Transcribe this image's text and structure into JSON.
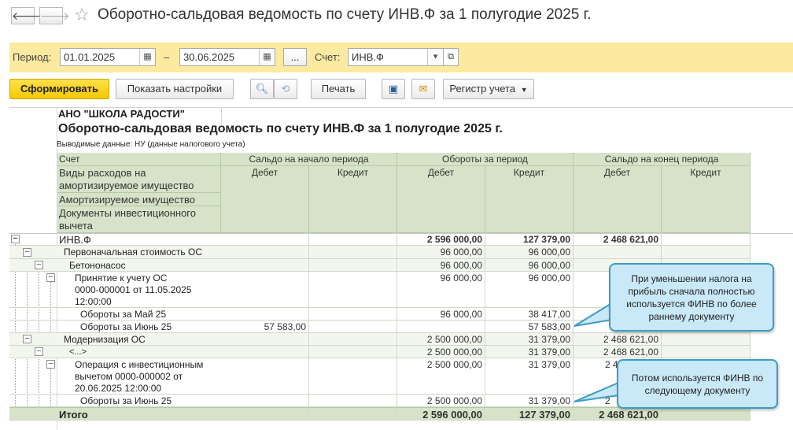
{
  "window": {
    "title": "Оборотно-сальдовая ведомость по счету ИНВ.Ф за 1 полугодие 2025 г.",
    "back_glyph": "🡐",
    "forward_glyph": "🡒",
    "star_glyph": "☆"
  },
  "params": {
    "period_label": "Период:",
    "date_from": "01.01.2025",
    "dash": "–",
    "date_to": "30.06.2025",
    "ellipsis": "...",
    "account_label": "Счет:",
    "account_value": "ИНВ.Ф"
  },
  "toolbar": {
    "generate": "Сформировать",
    "show_settings": "Показать настройки",
    "print": "Печать",
    "register": "Регистр учета"
  },
  "report": {
    "org": "АНО \"ШКОЛА РАДОСТИ\"",
    "title": "Оборотно-сальдовая ведомость по счету ИНВ.Ф за 1 полугодие 2025 г.",
    "output_data": "Выводимые данные: НУ (данные налогового учета)",
    "header": {
      "account": "Счет",
      "opening": "Сальдо на начало периода",
      "turnover": "Обороты за период",
      "closing": "Сальдо на конец периода",
      "debit": "Дебет",
      "credit": "Кредит",
      "subconto1_line1": "Виды расходов на",
      "subconto1_line2": "амортизируемое имущество",
      "subconto2": "Амортизируемое имущество",
      "subconto3_line1": "Документы инвестиционного",
      "subconto3_line2": "вычета"
    },
    "rows": [
      {
        "name": "ИНВ.Ф",
        "od": "",
        "oc": "",
        "td": "2 596 000,00",
        "tc": "127 379,00",
        "cd": "2 468 621,00",
        "cc": ""
      },
      {
        "name": "Первоначальная стоимость ОС",
        "od": "",
        "oc": "",
        "td": "96 000,00",
        "tc": "96 000,00",
        "cd": "",
        "cc": ""
      },
      {
        "name": "Бетононасос",
        "od": "",
        "oc": "",
        "td": "96 000,00",
        "tc": "96 000,00",
        "cd": "",
        "cc": ""
      },
      {
        "name1": "Принятие к учету ОС",
        "name2": "0000-000001 от 11.05.2025",
        "name3": "12:00:00",
        "od": "",
        "oc": "",
        "td": "96 000,00",
        "tc": "96 000,00",
        "cd": "",
        "cc": ""
      },
      {
        "name": "Обороты за Май 25",
        "od": "",
        "oc": "",
        "td": "96 000,00",
        "tc": "38 417,00",
        "cd": "",
        "cc": ""
      },
      {
        "name": "Обороты за Июнь 25",
        "od": "57 583,00",
        "oc": "",
        "td": "",
        "tc": "57 583,00",
        "cd": "",
        "cc": ""
      },
      {
        "name": "Модернизация ОС",
        "od": "",
        "oc": "",
        "td": "2 500 000,00",
        "tc": "31 379,00",
        "cd": "2 468 621,00",
        "cc": ""
      },
      {
        "name": "<...>",
        "od": "",
        "oc": "",
        "td": "2 500 000,00",
        "tc": "31 379,00",
        "cd": "2 468 621,00",
        "cc": ""
      },
      {
        "name1": "Операция с инвестиционным",
        "name2": "вычетом 0000-000002 от",
        "name3": "20.06.2025 12:00:00",
        "od": "",
        "oc": "",
        "td": "2 500 000,00",
        "tc": "31 379,00",
        "cd": "2 4",
        "cc": ""
      },
      {
        "name": "Обороты за Июнь 25",
        "od": "",
        "oc": "",
        "td": "2 500 000,00",
        "tc": "31 379,00",
        "cd": "2",
        "cc": ""
      },
      {
        "name": "Итого",
        "od": "",
        "oc": "",
        "td": "2 596 000,00",
        "tc": "127 379,00",
        "cd": "2 468 621,00",
        "cc": ""
      }
    ]
  },
  "callouts": {
    "first": "При уменьшении налога на прибыль сначала полностью используется ФИНВ по более раннему документу",
    "second": "Потом используется ФИНВ по следующему документу"
  }
}
